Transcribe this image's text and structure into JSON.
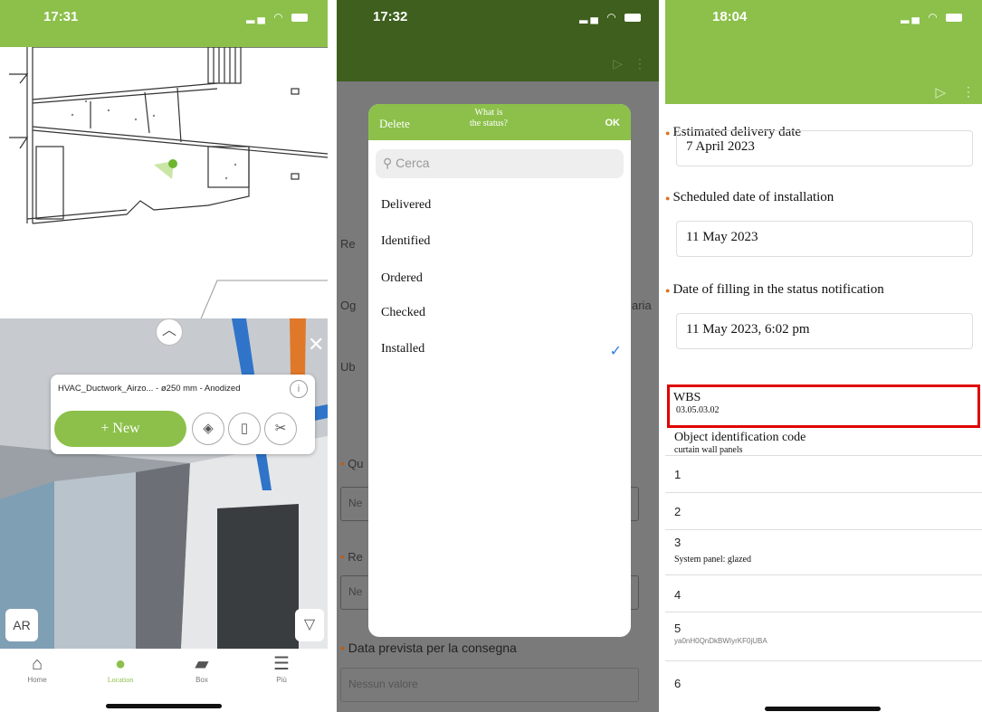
{
  "panel1": {
    "time": "17:31",
    "object_title": "HVAC_Ductwork_Airzo... - ø250 mm - Anodized",
    "new_button": "+ New",
    "ar_label": "AR",
    "tabs": [
      {
        "label": "Home",
        "icon": "home-icon"
      },
      {
        "label": "Location",
        "icon": "location-pin-icon"
      },
      {
        "label": "Box",
        "icon": "folder-icon"
      },
      {
        "label": "Più",
        "icon": "menu-icon"
      }
    ],
    "accent": "#8cc04a"
  },
  "panel2": {
    "time": "17:32",
    "header_color": "#3e5f1d",
    "background_labels": {
      "row1": "Re",
      "row2": "Og",
      "row2_right": "aria",
      "row3": "Ub",
      "qty": "Qu",
      "qty_placeholder": "Ne",
      "res": "Re",
      "res_placeholder": "Ne",
      "delivery_label": "Data prevista per la consegna",
      "delivery_placeholder": "Nessun valore"
    },
    "modal": {
      "delete": "Delete",
      "question_line1": "What is",
      "question_line2": "the status?",
      "ok": "OK",
      "search_placeholder": "Cerca",
      "options": [
        "Delivered",
        "Identified",
        "Ordered",
        "Checked",
        "Installed"
      ],
      "selected": "Installed"
    }
  },
  "panel3": {
    "time": "18:04",
    "fields": [
      {
        "label": "Estimated delivery date",
        "value": "7 April 2023"
      },
      {
        "label": "Scheduled date of installation",
        "value": "11 May 2023"
      },
      {
        "label": "Date of filling in the status notification",
        "value": "11 May 2023, 6:02 pm"
      }
    ],
    "wbs_label": "WBS",
    "wbs_value": "03.05.03.02",
    "object_code_label": "Object identification code",
    "object_code_value": "curtain wall panels",
    "rows": [
      {
        "num": "1",
        "sub": ""
      },
      {
        "num": "2",
        "sub": ""
      },
      {
        "num": "3",
        "sub": "System panel: glazed"
      },
      {
        "num": "4",
        "sub": ""
      },
      {
        "num": "5",
        "sub": "ya0nH0QnDkBWIyrKF0jUBA"
      },
      {
        "num": "6",
        "sub": ""
      }
    ],
    "highlight_color": "#e00000"
  }
}
